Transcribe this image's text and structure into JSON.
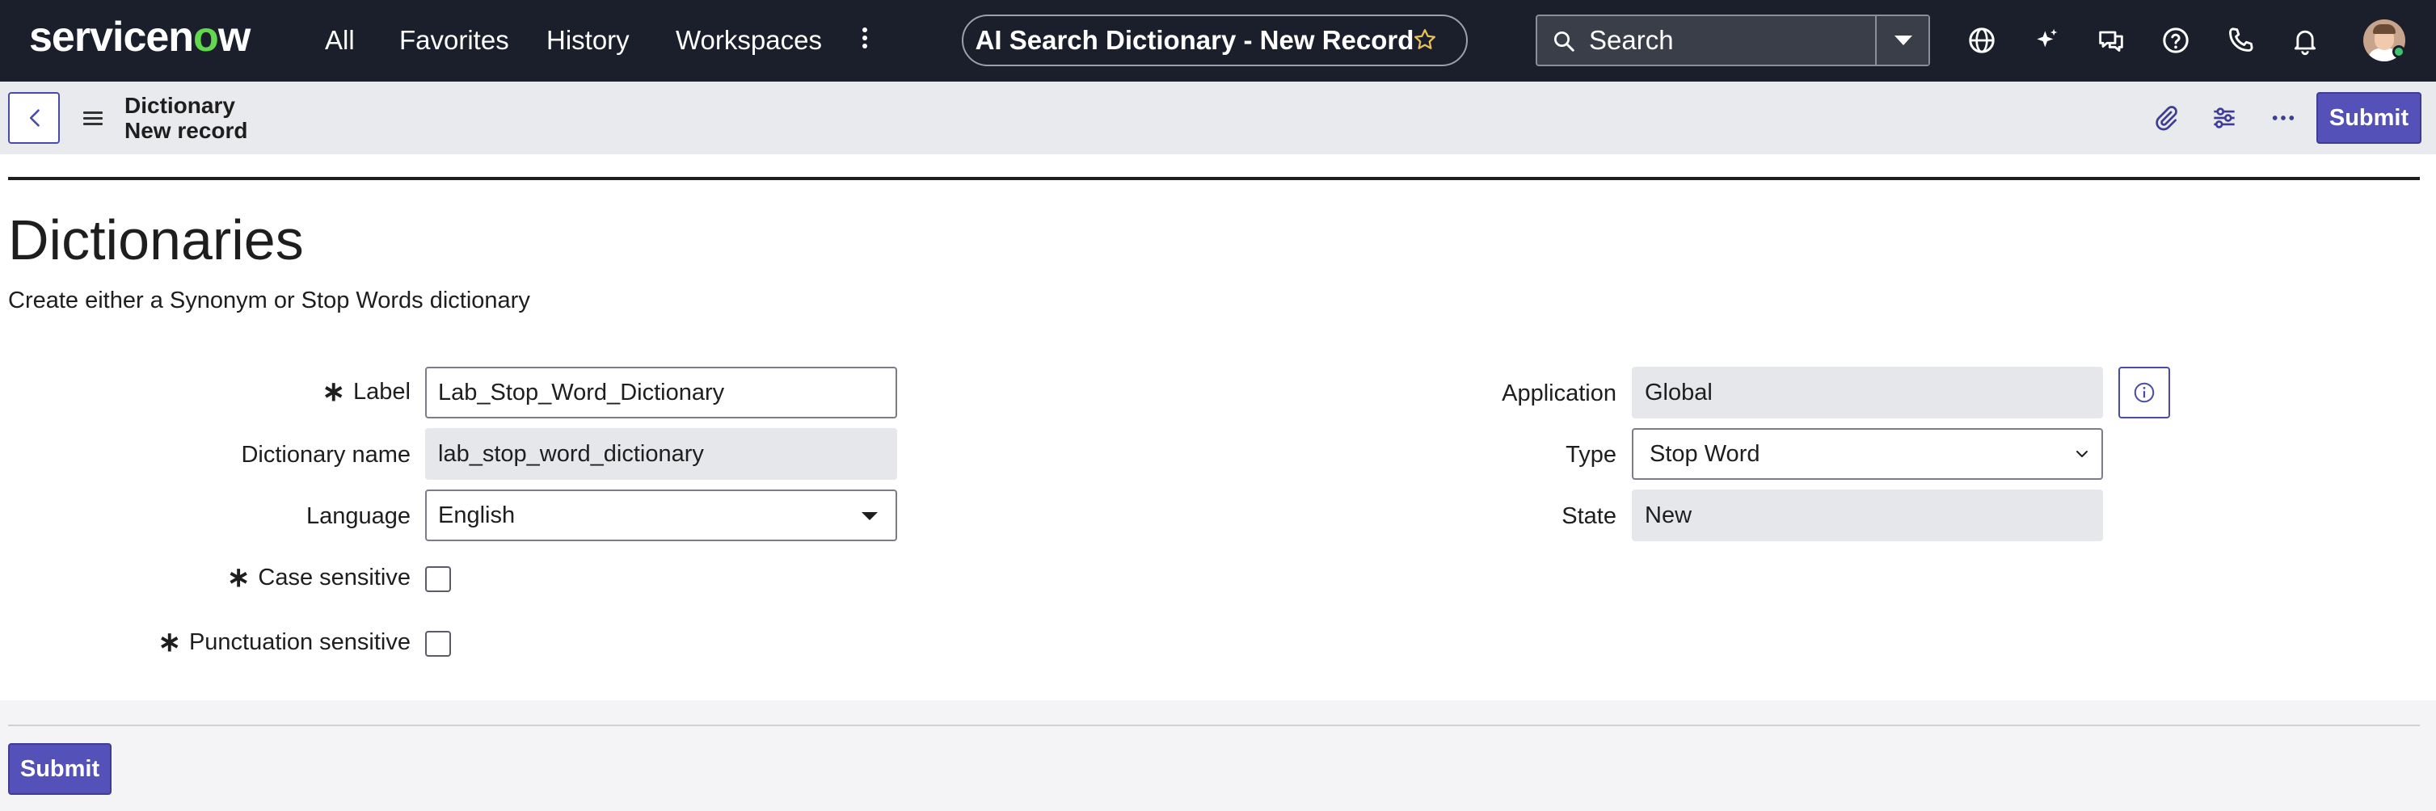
{
  "nav": {
    "logo_pre": "servicen",
    "logo_o": "o",
    "logo_post": "w",
    "links": [
      "All",
      "Favorites",
      "History",
      "Workspaces"
    ],
    "title": "AI Search Dictionary - New Record",
    "search_placeholder": "Search"
  },
  "subheader": {
    "breadcrumb_table": "Dictionary",
    "breadcrumb_record": "New record",
    "submit_label": "Submit"
  },
  "form": {
    "title": "Dictionaries",
    "subtitle": "Create either a Synonym or Stop Words dictionary",
    "required_marker": "∗",
    "label_label": "Label",
    "label_value": "Lab_Stop_Word_Dictionary",
    "dictionary_name_label": "Dictionary name",
    "dictionary_name_value": "lab_stop_word_dictionary",
    "language_label": "Language",
    "language_value": "English",
    "case_sensitive_label": "Case sensitive",
    "case_sensitive_checked": false,
    "punctuation_sensitive_label": "Punctuation sensitive",
    "punctuation_sensitive_checked": false,
    "application_label": "Application",
    "application_value": "Global",
    "type_label": "Type",
    "type_value": "Stop Word",
    "state_label": "State",
    "state_value": "New"
  },
  "footer": {
    "submit_label": "Submit"
  },
  "colors": {
    "nav_bg": "#1b1f2b",
    "accent": "#5451b8",
    "logo_o": "#62d84e",
    "readonly_field": "#e6e7eb"
  }
}
